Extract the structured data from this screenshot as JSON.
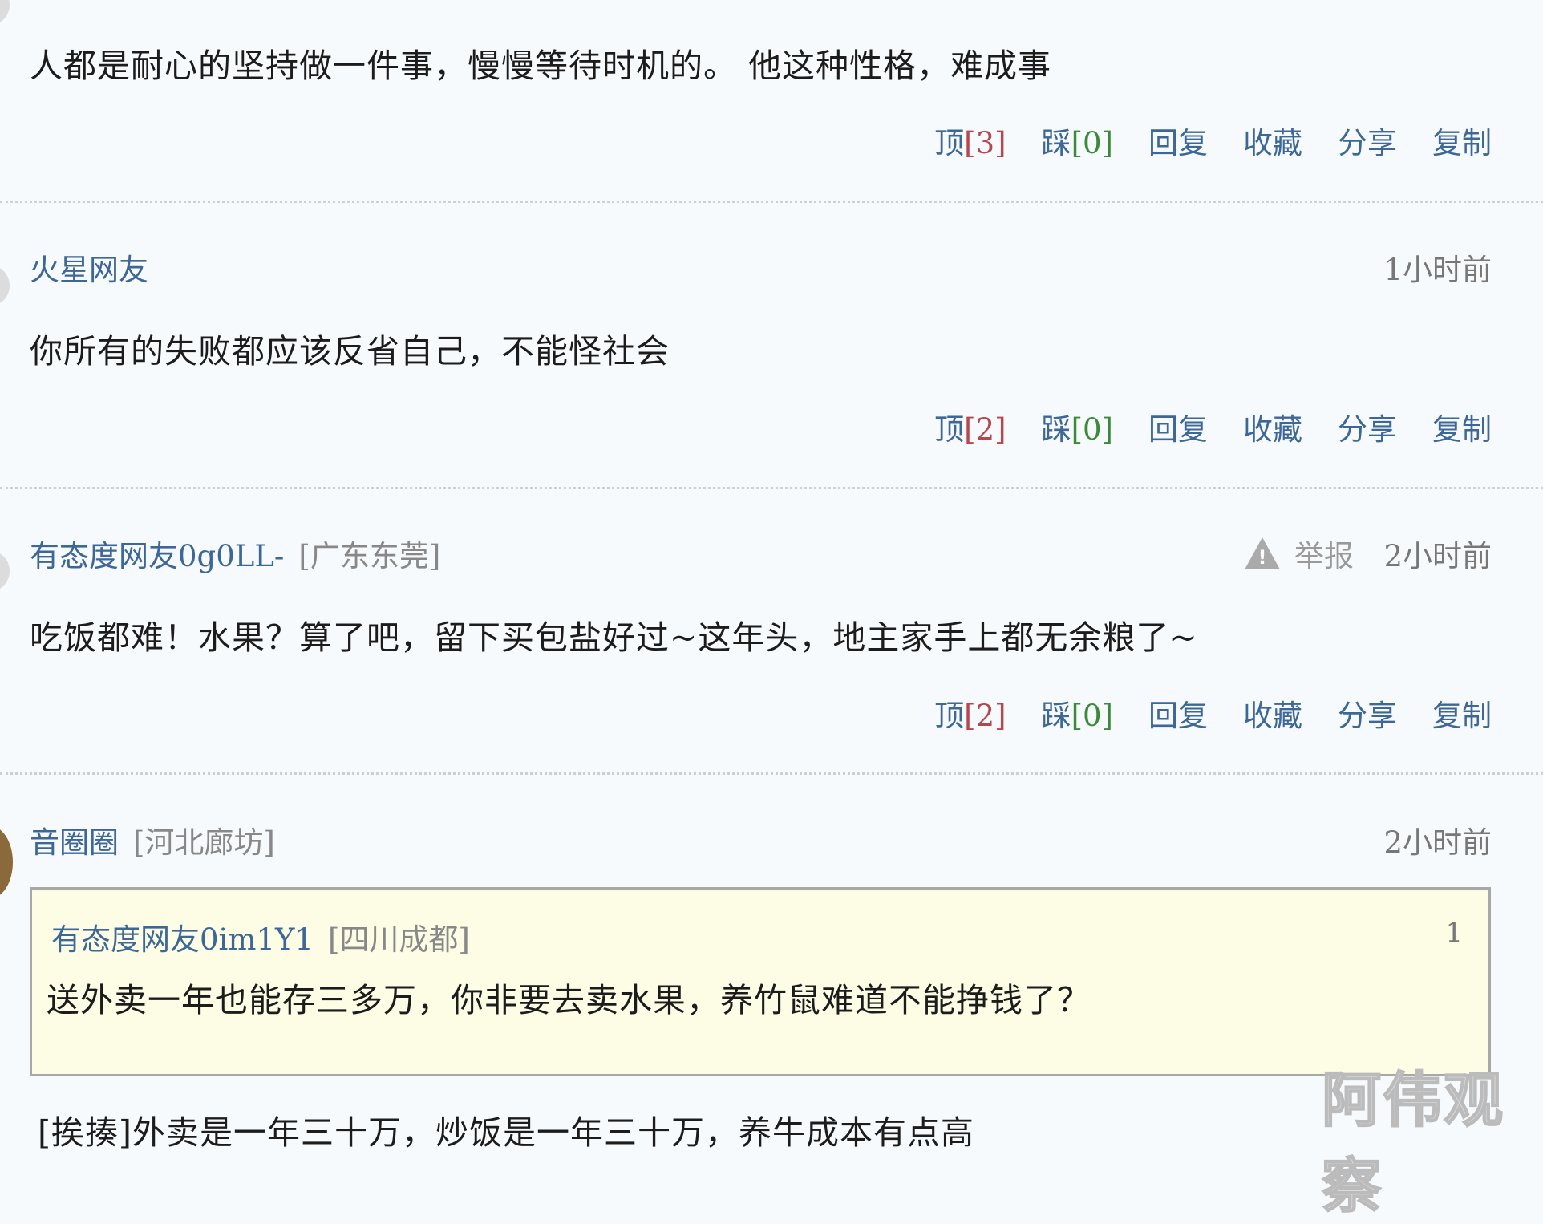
{
  "comments": [
    {
      "text": "人都是耐心的坚持做一件事，慢慢等待时机的。 他这种性格，难成事",
      "actions": {
        "up_label": "顶",
        "up_count": "[3]",
        "down_label": "踩",
        "down_count": "[0]",
        "reply": "回复",
        "collect": "收藏",
        "share": "分享",
        "copy": "复制"
      }
    },
    {
      "user": "火星网友",
      "time": "1小时前",
      "text": "你所有的失败都应该反省自己，不能怪社会",
      "actions": {
        "up_label": "顶",
        "up_count": "[2]",
        "down_label": "踩",
        "down_count": "[0]",
        "reply": "回复",
        "collect": "收藏",
        "share": "分享",
        "copy": "复制"
      }
    },
    {
      "user": "有态度网友0g0LL-",
      "location": "[广东东莞]",
      "report": "举报",
      "time": "2小时前",
      "text": "吃饭都难！水果？算了吧，留下买包盐好过~这年头，地主家手上都无余粮了~",
      "actions": {
        "up_label": "顶",
        "up_count": "[2]",
        "down_label": "踩",
        "down_count": "[0]",
        "reply": "回复",
        "collect": "收藏",
        "share": "分享",
        "copy": "复制"
      }
    },
    {
      "user": "音圈圈",
      "location": "[河北廊坊]",
      "time": "2小时前",
      "quote": {
        "user": "有态度网友0im1Y1",
        "location": "[四川成都]",
        "floor": "1",
        "text": "送外卖一年也能存三多万，你非要去卖水果，养竹鼠难道不能挣钱了？"
      },
      "text": "[挨揍]外卖是一年三十万，炒饭是一年三十万，养牛成本有点高"
    }
  ],
  "watermark": "阿伟观察",
  "icons": {
    "report": "warning-triangle-icon"
  }
}
